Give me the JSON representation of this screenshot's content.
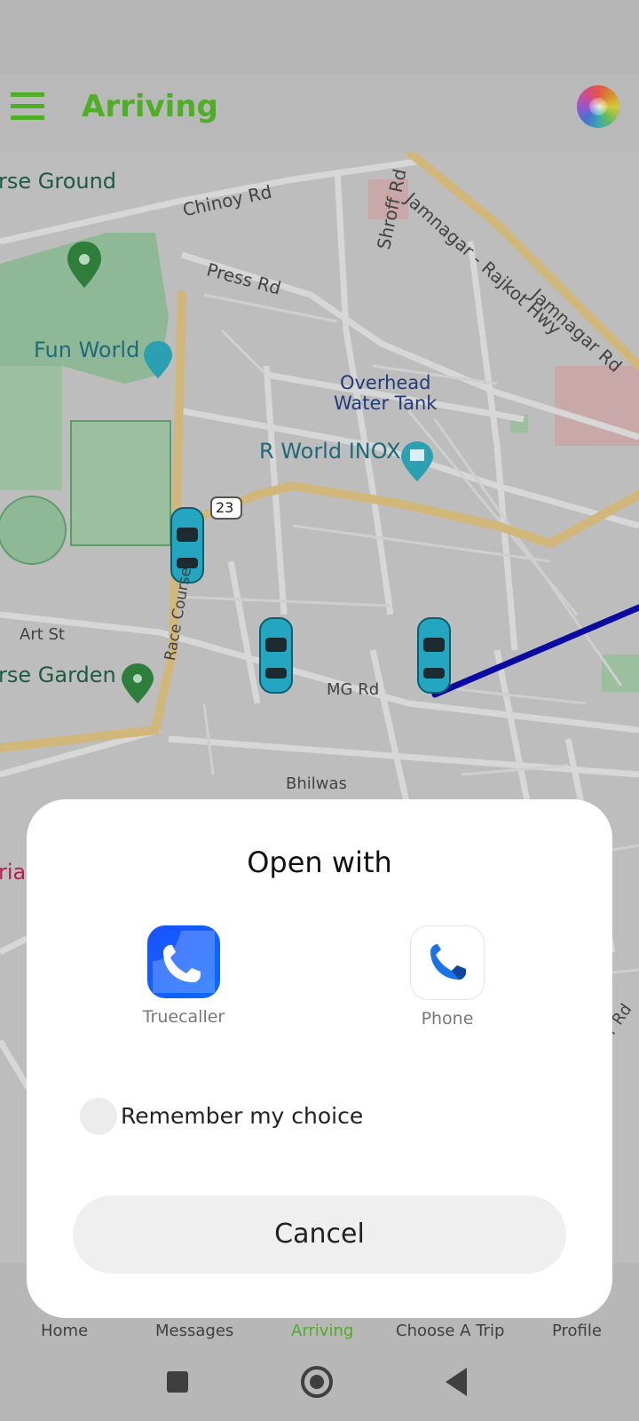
{
  "app_bar": {
    "title": "Arriving"
  },
  "map": {
    "labels": {
      "horse_ground": "rse Ground",
      "chinoy_rd": "Chinoy Rd",
      "press_rd": "Press Rd",
      "shroff_rd": "Shroff Rd",
      "jamnagar_rajkot_hwy": "Jamnagar - Rajkot Hwy",
      "jamnagar_rd": "Jamnagar Rd",
      "fun_world": "Fun World",
      "overhead_water_tank": "Overhead\nWater Tank",
      "r_world_inox": "R World INOX",
      "route_23": "23",
      "art_st": "Art St",
      "race_course": "Race Course",
      "horse_garden": "rse Garden",
      "mg_rd": "MG Rd",
      "bhilwas": "Bhilwas",
      "left_cut": "rial",
      "right_cut": "r Rd"
    }
  },
  "dialog": {
    "title": "Open with",
    "apps": [
      {
        "name": "Truecaller",
        "icon": "truecaller-icon"
      },
      {
        "name": "Phone",
        "icon": "phone-icon"
      }
    ],
    "remember_label": "Remember my choice",
    "cancel_label": "Cancel"
  },
  "bottom_nav": {
    "items": [
      "Home",
      "Messages",
      "Arriving",
      "Choose A Trip",
      "Profile"
    ],
    "active": "Arriving"
  },
  "colors": {
    "accent": "#4fae25",
    "route": "#0a0aa0",
    "car": "#24a6c1"
  }
}
